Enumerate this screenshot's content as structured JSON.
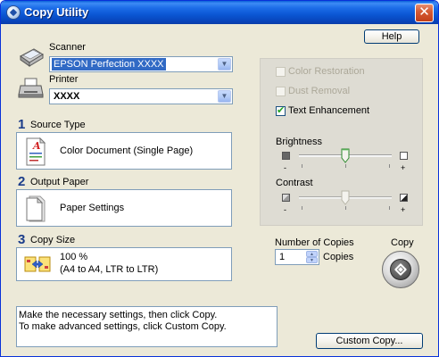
{
  "window": {
    "title": "Copy Utility"
  },
  "toolbar": {
    "help_label": "Help"
  },
  "scanner": {
    "label": "Scanner",
    "value": "EPSON Perfection XXXX"
  },
  "printer": {
    "label": "Printer",
    "value": "XXXX"
  },
  "steps": [
    {
      "number": "1",
      "title": "Source Type",
      "text": "Color Document (Single Page)",
      "icon": "color-document-icon"
    },
    {
      "number": "2",
      "title": "Output Paper",
      "text": "Paper Settings",
      "icon": "paper-icon"
    },
    {
      "number": "3",
      "title": "Copy Size",
      "line1": "100 %",
      "line2": "(A4 to A4, LTR to LTR)",
      "icon": "copy-size-icon"
    }
  ],
  "options": {
    "color_restoration": {
      "label": "Color Restoration",
      "checked": false,
      "enabled": false
    },
    "dust_removal": {
      "label": "Dust Removal",
      "checked": false,
      "enabled": false
    },
    "text_enhancement": {
      "label": "Text Enhancement",
      "checked": true,
      "enabled": true
    }
  },
  "brightness": {
    "label": "Brightness",
    "minus": "-",
    "plus": "+",
    "level": 0.5
  },
  "contrast": {
    "label": "Contrast",
    "minus": "-",
    "plus": "+",
    "level": 0.5
  },
  "copies": {
    "label": "Number of Copies",
    "value": "1",
    "unit": "Copies"
  },
  "copy_button": {
    "label": "Copy"
  },
  "status": {
    "line1": "Make the necessary settings, then click Copy.",
    "line2": "To make advanced settings, click Custom Copy."
  },
  "custom_copy": {
    "label": "Custom Copy..."
  },
  "colors": {
    "title_bar": "#0a56d3",
    "close": "#c23e19",
    "accent": "#316ac5",
    "step_number": "#1a3c8a"
  }
}
